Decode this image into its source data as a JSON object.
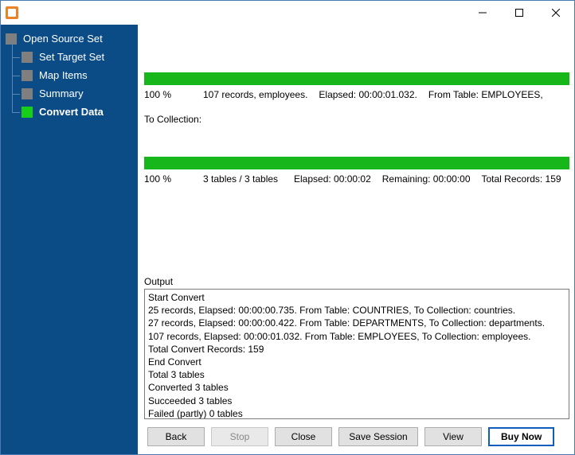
{
  "sidebar": {
    "root": "Open Source Set",
    "items": [
      {
        "label": "Set Target Set",
        "active": false,
        "bold": false
      },
      {
        "label": "Map Items",
        "active": false,
        "bold": false
      },
      {
        "label": "Summary",
        "active": false,
        "bold": false
      },
      {
        "label": "Convert Data",
        "active": true,
        "bold": true
      }
    ]
  },
  "progress": {
    "top": {
      "percent": "100 %",
      "records": "107 records, employees.",
      "elapsed": "Elapsed: 00:00:01.032.",
      "from": "From Table: EMPLOYEES,",
      "to": "To Collection:"
    },
    "overall": {
      "percent": "100 %",
      "tables": "3 tables / 3 tables",
      "elapsed": "Elapsed: 00:00:02",
      "remaining": "Remaining: 00:00:00",
      "total": "Total Records: 159"
    }
  },
  "output": {
    "label": "Output",
    "text": "Start Convert\n25 records,    Elapsed: 00:00:00.735.    From Table: COUNTRIES,    To Collection: countries.\n27 records,    Elapsed: 00:00:00.422.    From Table: DEPARTMENTS,    To Collection: departments.\n107 records,    Elapsed: 00:00:01.032.    From Table: EMPLOYEES,    To Collection: employees.\nTotal Convert Records: 159\nEnd Convert\nTotal 3 tables\nConverted 3 tables\nSucceeded 3 tables\nFailed (partly) 0 tables"
  },
  "buttons": {
    "back": "Back",
    "stop": "Stop",
    "close": "Close",
    "save_session": "Save Session",
    "view": "View",
    "buy_now": "Buy Now"
  }
}
